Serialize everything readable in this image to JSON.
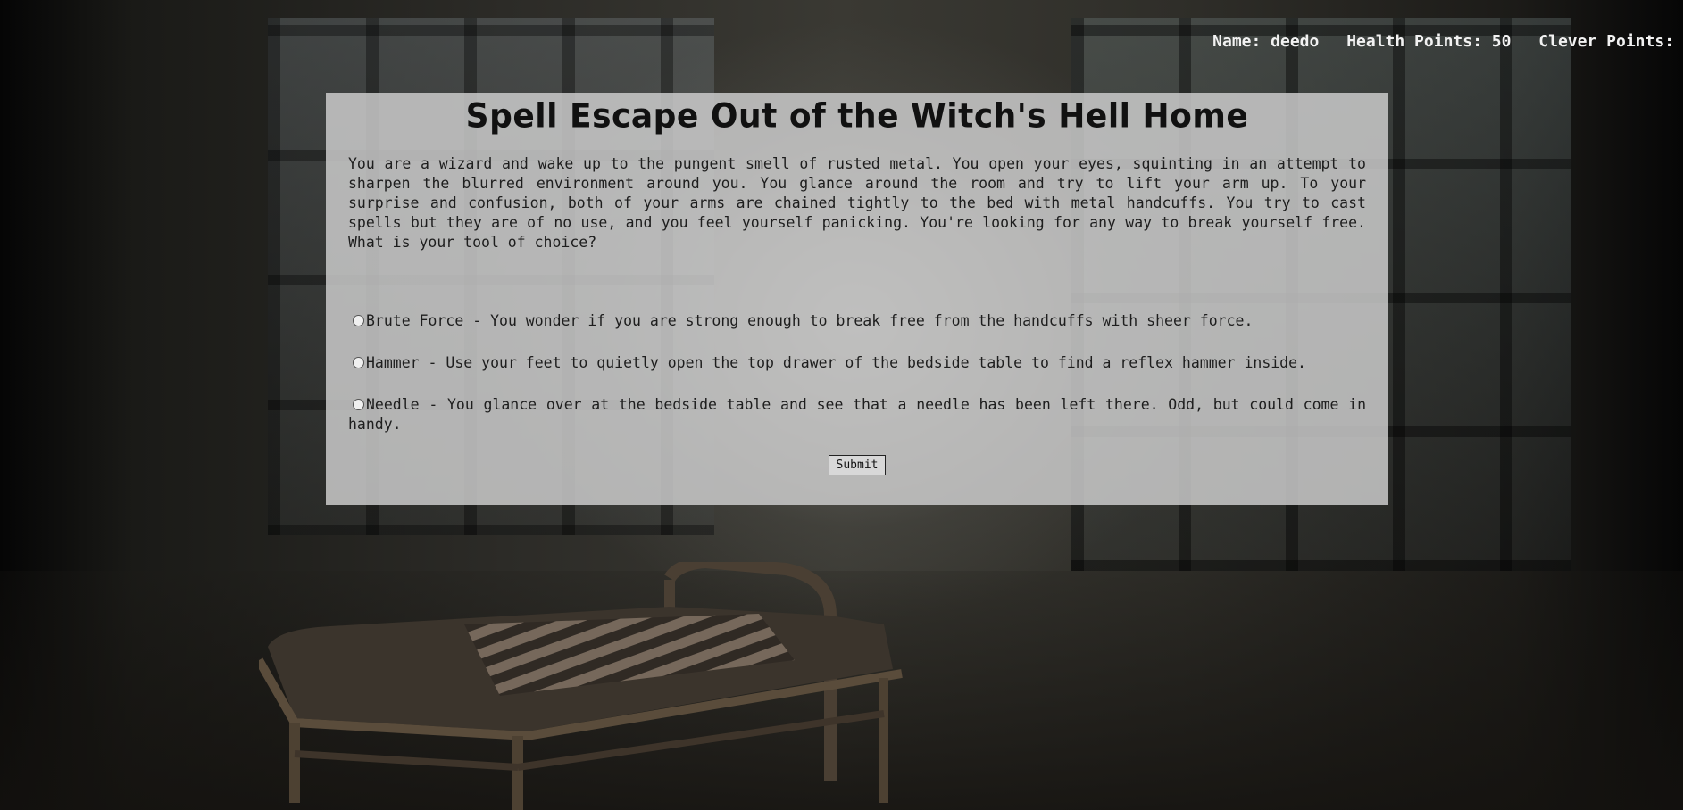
{
  "stats": {
    "name_label": "Name: deedo",
    "health_label": "Health Points: 50",
    "clever_label": "Clever Points:"
  },
  "game": {
    "title": "Spell Escape Out of the Witch's Hell Home",
    "story": "You are a wizard and wake up to the pungent smell of rusted metal. You open your eyes, squinting in an attempt to sharpen the blurred environment around you. You glance around the room and try to lift your arm up. To your surprise and confusion, both of your arms are chained tightly to the bed with metal handcuffs. You try to cast spells but they are of no use, and you feel yourself panicking. You're looking for any way to break yourself free. What is your tool of choice?",
    "choices": [
      {
        "label": "Brute Force - You wonder if you are strong enough to break free from the handcuffs with sheer force.",
        "selected": false
      },
      {
        "label": "Hammer - Use your feet to quietly open the top drawer of the bedside table to find a reflex hammer inside.",
        "selected": false
      },
      {
        "label": "Needle - You glance over at the bedside table and see that a needle has been left there. Odd, but could come in handy.",
        "selected": false
      }
    ],
    "submit_label": "Submit"
  }
}
